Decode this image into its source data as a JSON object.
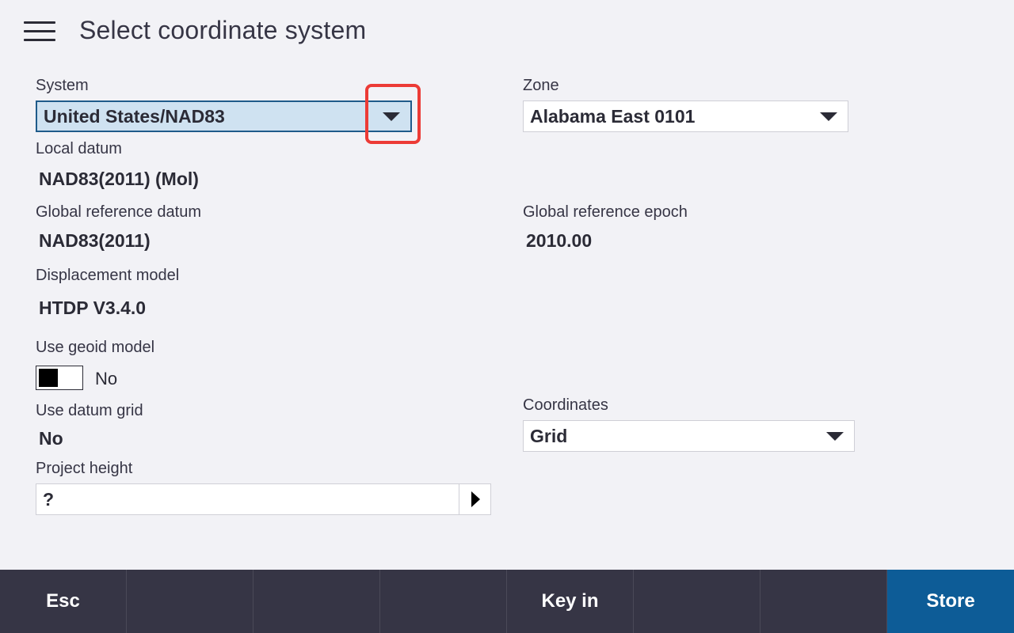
{
  "header": {
    "title": "Select coordinate system",
    "menu_icon": "hamburger-menu-icon"
  },
  "system": {
    "label": "System",
    "value": "United States/NAD83",
    "highlight_color": "#ec3b36"
  },
  "zone": {
    "label": "Zone",
    "value": "Alabama East 0101"
  },
  "local_datum": {
    "label": "Local datum",
    "value": "NAD83(2011) (Mol)"
  },
  "global_reference_datum": {
    "label": "Global reference datum",
    "value": "NAD83(2011)"
  },
  "global_reference_epoch": {
    "label": "Global reference epoch",
    "value": "2010.00"
  },
  "displacement_model": {
    "label": "Displacement model",
    "value": "HTDP V3.4.0"
  },
  "use_geoid_model": {
    "label": "Use geoid model",
    "state_text": "No",
    "on": false
  },
  "use_datum_grid": {
    "label": "Use datum grid",
    "value": "No"
  },
  "coordinates": {
    "label": "Coordinates",
    "value": "Grid"
  },
  "project_height": {
    "label": "Project height",
    "value": "?"
  },
  "bottom_bar": {
    "buttons": [
      "Esc",
      "",
      "",
      "",
      "Key in",
      "",
      "",
      "Store"
    ],
    "background": "#363545",
    "primary_color": "#0d5c97"
  }
}
